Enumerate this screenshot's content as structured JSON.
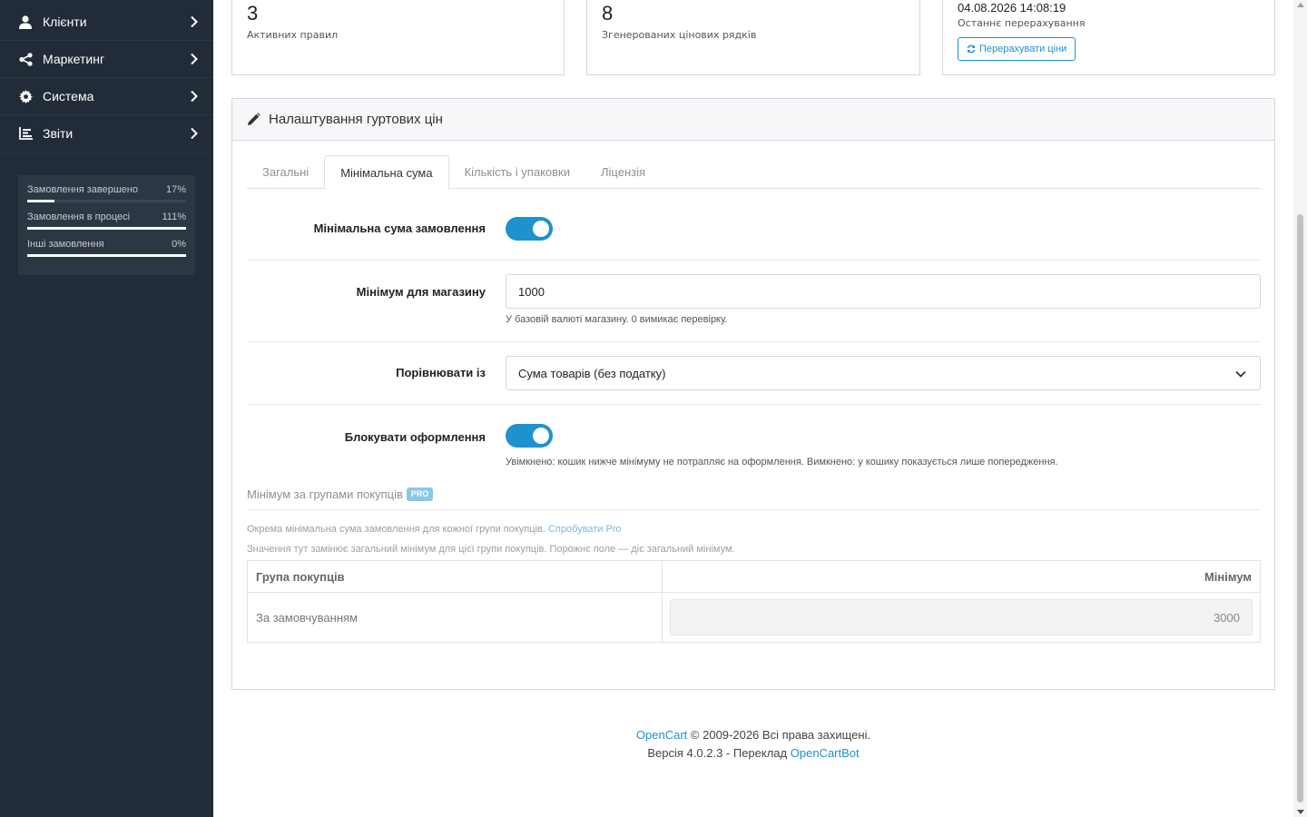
{
  "sidebar": {
    "items": [
      {
        "label": "Клієнти",
        "icon": "user-icon"
      },
      {
        "label": "Маркетинг",
        "icon": "share-icon"
      },
      {
        "label": "Система",
        "icon": "gear-icon"
      },
      {
        "label": "Звіти",
        "icon": "bar-chart-icon"
      }
    ],
    "stats": [
      {
        "label": "Замовлення завершено",
        "value": "17%",
        "fill_percent": 17
      },
      {
        "label": "Замовлення в процесі",
        "value": "111%",
        "fill_percent": 100
      },
      {
        "label": "Інші замовлення",
        "value": "0%",
        "fill_percent": 100
      }
    ]
  },
  "cards": {
    "active_rules": {
      "value": "3",
      "caption": "Активних правил"
    },
    "generated_rows": {
      "value": "8",
      "caption": "Згенерованих цінових рядків"
    },
    "recalc": {
      "date": "04.08.2026 14:08:19",
      "caption": "Останнє перерахування",
      "button_label": "Перерахувати ціни"
    }
  },
  "panel": {
    "title": "Налаштування гуртових цін",
    "tabs": [
      {
        "label": "Загальні",
        "active": false
      },
      {
        "label": "Мінімальна сума",
        "active": true
      },
      {
        "label": "Кількість і упаковки",
        "active": false
      },
      {
        "label": "Ліцензія",
        "active": false
      }
    ],
    "fields": {
      "min_order_enabled": {
        "label": "Мінімальна сума замовлення",
        "value": true
      },
      "store_min": {
        "label": "Мінімум для магазину",
        "value": "1000",
        "help": "У базовій валюті магазину. 0 вимикає перевірку."
      },
      "compare_with": {
        "label": "Порівнювати із",
        "value": "Сума товарів (без податку)"
      },
      "block_checkout": {
        "label": "Блокувати оформлення",
        "value": true,
        "help": "Увімкнено: кошик нижче мінімуму не потрапляє на оформлення. Вимкнено: у кошику показується лише попередження."
      }
    },
    "pro": {
      "title": "Мінімум за групами покупців",
      "badge": "PRO",
      "text1": "Окрема мінімальна сума замовлення для кожної групи покупців.",
      "link": "Спробувати Pro",
      "text2": "Значення тут замінює загальний мінімум для цієї групи покупців. Порожнє поле — діє загальний мінімум.",
      "table": {
        "headers": [
          "Група покупців",
          "Мінімум"
        ],
        "rows": [
          {
            "group": "За замовчуванням",
            "min": "3000"
          }
        ]
      }
    }
  },
  "footer": {
    "brand": "OpenCart",
    "copyright": "© 2009-2026 Всі права захищені.",
    "version": "Версія 4.0.2.3 - Переклад",
    "translator": "OpenCartBot"
  },
  "colors": {
    "sidebar_bg": "#222c38",
    "accent": "#1e91cf"
  }
}
